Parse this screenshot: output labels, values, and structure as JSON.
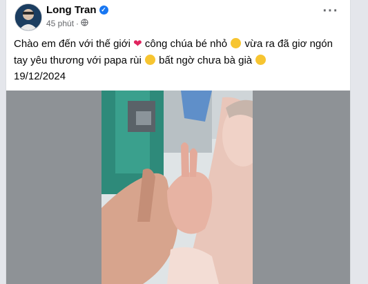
{
  "post": {
    "author": "Long Tran",
    "time": "45 phút",
    "separator": "·",
    "text_line1_a": "Chào em đến với thế giới",
    "text_line1_b": "công chúa bé nhỏ",
    "text_line1_c": "vừa ra đã giơ ngón",
    "text_line2_a": "tay yêu thương với papa rùi",
    "text_line2_b": "bất ngờ chưa bà già",
    "date": "19/12/2024"
  },
  "icons": {
    "verified": "verified-badge-icon",
    "audience": "globe-icon",
    "more": "more-options-icon",
    "emojis": [
      "red-heart",
      "grimacing-face",
      "laughing-crying-face",
      "smiling-face"
    ]
  },
  "colors": {
    "verified": "#1877f2",
    "text": "#050505",
    "secondary": "#65676b"
  }
}
